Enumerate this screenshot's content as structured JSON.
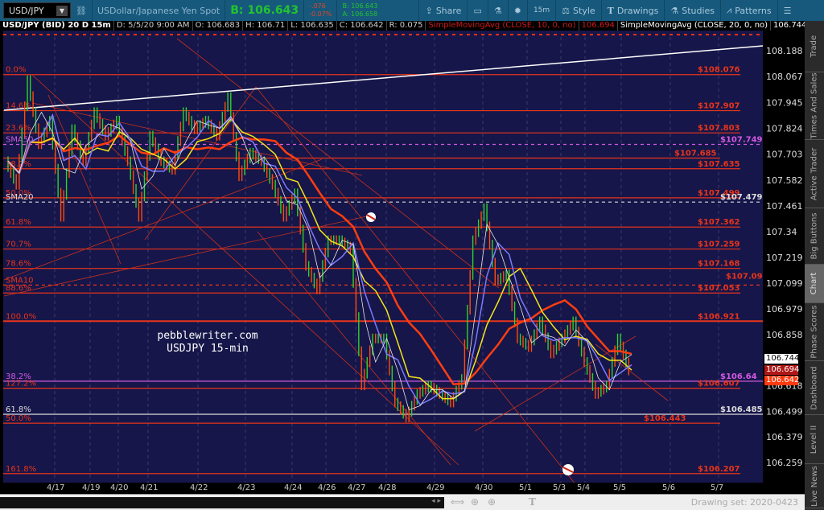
{
  "toolbar": {
    "symbol": "USD/JPY",
    "description": "USDollar/Japanese Yen Spot",
    "bid": "B: 106.643",
    "change": "-.076",
    "change_pct": "-0.07%",
    "bid_small": "B: 106.643",
    "ask_small": "A: 106.658",
    "buttons": [
      "Share",
      "15m",
      "Style",
      "Drawings",
      "Studies",
      "Patterns"
    ]
  },
  "infobar": {
    "title": "USD/JPY (BID) 20 D 15m",
    "date": "D: 5/5/20 9:00 AM",
    "open": "O: 106.683",
    "high": "H: 106.71",
    "low": "L: 106.635",
    "close": "C: 106.642",
    "range": "R: 0.075",
    "sma10": "SimpleMovingAvg (CLOSE, 10, 0, no)",
    "sma10_val": "106.694",
    "sma20": "SimpleMovingAvg (CLOSE, 20, 0, no)",
    "sma20_val": "106.744",
    "more": "..."
  },
  "watermark": {
    "line1": "pebblewriter.com",
    "line2": "USDJPY 15-min"
  },
  "price_axis": {
    "ticks": [
      108.188,
      108.067,
      107.945,
      107.824,
      107.703,
      107.582,
      107.461,
      107.34,
      107.219,
      107.099,
      106.979,
      106.858,
      106.618,
      106.499,
      106.379,
      106.259
    ],
    "tags": [
      {
        "text": "106.744",
        "price": 106.744,
        "bg": "#ffffff",
        "fg": "#000000"
      },
      {
        "text": "106.694",
        "price": 106.694,
        "bg": "#b01818",
        "fg": "#ffffff"
      },
      {
        "text": "106.642",
        "price": 106.642,
        "bg": "#ff3a10",
        "fg": "#ffffff"
      }
    ]
  },
  "levels": [
    {
      "left": "0.0%",
      "right": "$108.076",
      "price": 108.076,
      "color": "#e8341a",
      "style": "solid"
    },
    {
      "left": "14.6%",
      "right": "$107.907",
      "price": 107.907,
      "color": "#e8341a",
      "style": "solid"
    },
    {
      "left": "23.6%",
      "right": "$107.803",
      "price": 107.803,
      "color": "#e8341a",
      "style": "solid"
    },
    {
      "left": "SMA50",
      "right": "$107.749",
      "price": 107.749,
      "color": "#d25ae0",
      "style": "dashed"
    },
    {
      "left": "",
      "right": "$107.685",
      "price": 107.685,
      "color": "#e8341a",
      "style": "short"
    },
    {
      "left": "38.2%",
      "right": "$107.635",
      "price": 107.635,
      "color": "#e8341a",
      "style": "solid"
    },
    {
      "left": "50.0%",
      "right": "$107.499",
      "price": 107.499,
      "color": "#e8341a",
      "style": "solid"
    },
    {
      "left": "SMA20",
      "right": "$107.479",
      "price": 107.479,
      "color": "#dddddd",
      "style": "dashed"
    },
    {
      "left": "61.8%",
      "right": "$107.362",
      "price": 107.362,
      "color": "#e8341a",
      "style": "solid"
    },
    {
      "left": "70.7%",
      "right": "$107.259",
      "price": 107.259,
      "color": "#e8341a",
      "style": "solid"
    },
    {
      "left": "78.6%",
      "right": "$107.168",
      "price": 107.168,
      "color": "#e8341a",
      "style": "solid"
    },
    {
      "left": "SMA10",
      "right": "$107.09",
      "price": 107.09,
      "color": "#e8341a",
      "style": "dashed"
    },
    {
      "left": "88.6%",
      "right": "$107.053",
      "price": 107.053,
      "color": "#e8341a",
      "style": "solid"
    },
    {
      "left": "100.0%",
      "right": "$106.921",
      "price": 106.921,
      "color": "#e8341a",
      "style": "thick"
    },
    {
      "left": "38.2%",
      "right": "$106.64",
      "price": 106.64,
      "color": "#d25ae0",
      "style": "solid"
    },
    {
      "left": "127.2%",
      "right": "$106.607",
      "price": 106.607,
      "color": "#e8341a",
      "style": "solid"
    },
    {
      "left": "61.8%",
      "right": "$106.485",
      "price": 106.485,
      "color": "#dddddd",
      "style": "solid"
    },
    {
      "left": "50.0%",
      "right": "$106.443",
      "price": 106.443,
      "color": "#e8341a",
      "style": "short"
    },
    {
      "left": "161.8%",
      "right": "$106.207",
      "price": 106.207,
      "color": "#e8341a",
      "style": "solid"
    }
  ],
  "chart_data": {
    "type": "line",
    "title": "USD/JPY (BID) 20 D 15m",
    "x_labels": [
      "4/17",
      "4/19",
      "4/20",
      "4/21",
      "4/22",
      "4/23",
      "4/24",
      "4/26",
      "4/27",
      "4/28",
      "4/29",
      "4/30",
      "5/1",
      "5/3",
      "5/4",
      "5/5",
      "5/6",
      "5/7"
    ],
    "close": [
      107.67,
      107.56,
      108.05,
      107.75,
      107.86,
      107.41,
      107.82,
      107.67,
      107.9,
      107.79,
      107.86,
      107.67,
      107.41,
      107.79,
      107.67,
      107.63,
      107.9,
      107.82,
      107.86,
      107.79,
      107.97,
      107.6,
      107.71,
      107.67,
      107.56,
      107.41,
      107.52,
      107.18,
      107.07,
      107.3,
      107.3,
      107.26,
      106.62,
      106.84,
      106.84,
      106.54,
      106.47,
      106.58,
      106.62,
      106.58,
      106.54,
      106.65,
      107.3,
      107.45,
      107.11,
      107.14,
      106.84,
      106.8,
      106.92,
      106.77,
      106.84,
      106.92,
      106.73,
      106.58,
      106.62,
      106.84,
      106.69
    ],
    "ylim": [
      106.16,
      108.27
    ]
  },
  "side_tabs": [
    "Trade",
    "Times And Sales",
    "Active Trader",
    "Big Buttons",
    "Chart",
    "Phase Scores",
    "Dashboard",
    "Level II",
    "Live News"
  ],
  "bottom": {
    "drawing_set": "Drawing set: 2020-0423"
  }
}
